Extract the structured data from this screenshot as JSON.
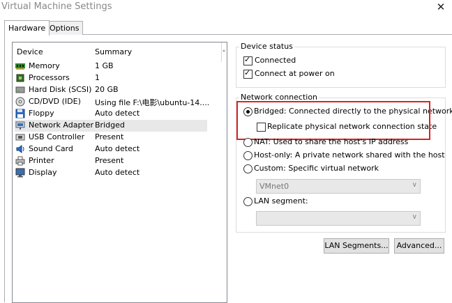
{
  "window": {
    "title": "Virtual Machine Settings",
    "close_glyph": "✕"
  },
  "tabs": [
    {
      "label": "Hardware"
    },
    {
      "label": "Options"
    }
  ],
  "device_list": {
    "columns": {
      "device": "Device",
      "summary": "Summary"
    },
    "rows": [
      {
        "device": "Memory",
        "summary": "1 GB",
        "icon": "memory-icon"
      },
      {
        "device": "Processors",
        "summary": "1",
        "icon": "processor-icon"
      },
      {
        "device": "Hard Disk (SCSI)",
        "summary": "20 GB",
        "icon": "hard-disk-icon"
      },
      {
        "device": "CD/DVD (IDE)",
        "summary": "Using file F:\\电影\\ubuntu-14....",
        "icon": "cd-dvd-icon"
      },
      {
        "device": "Floppy",
        "summary": "Auto detect",
        "icon": "floppy-icon"
      },
      {
        "device": "Network Adapter",
        "summary": "Bridged",
        "icon": "network-adapter-icon",
        "selected": true
      },
      {
        "device": "USB Controller",
        "summary": "Present",
        "icon": "usb-icon"
      },
      {
        "device": "Sound Card",
        "summary": "Auto detect",
        "icon": "sound-card-icon"
      },
      {
        "device": "Printer",
        "summary": "Present",
        "icon": "printer-icon"
      },
      {
        "device": "Display",
        "summary": "Auto detect",
        "icon": "display-icon"
      }
    ]
  },
  "device_status": {
    "label": "Device status",
    "connected": {
      "label": "Connected",
      "checked": true
    },
    "connect_at_power_on": {
      "label": "Connect at power on",
      "checked": true
    }
  },
  "network_connection": {
    "label": "Network connection",
    "bridged": {
      "label": "Bridged: Connected directly to the physical network",
      "selected": true
    },
    "replicate": {
      "label": "Replicate physical network connection state",
      "checked": false
    },
    "nat": {
      "label": "NAT: Used to share the host's IP address",
      "selected": false
    },
    "host_only": {
      "label": "Host-only: A private network shared with the host",
      "selected": false
    },
    "custom": {
      "label": "Custom: Specific virtual network",
      "selected": false
    },
    "custom_select": {
      "value": "VMnet0"
    },
    "lan_segment": {
      "label": "LAN segment:",
      "selected": false
    },
    "lan_select": {
      "value": ""
    }
  },
  "buttons": {
    "lan_segments": "LAN Segments...",
    "advanced": "Advanced..."
  },
  "colors": {
    "highlight": "#e02020",
    "selected_row": "#e8e8e8"
  }
}
